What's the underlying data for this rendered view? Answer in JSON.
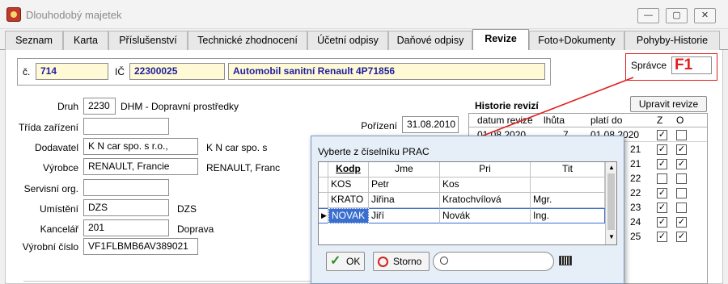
{
  "window": {
    "title": "Dlouhodobý majetek",
    "min_label": "—",
    "max_label": "▢",
    "close_label": "✕"
  },
  "tabs": [
    {
      "label": "Seznam"
    },
    {
      "label": "Karta"
    },
    {
      "label": "Příslušenství"
    },
    {
      "label": "Technické zhodnocení"
    },
    {
      "label": "Účetní odpisy"
    },
    {
      "label": "Daňové odpisy"
    },
    {
      "label": "Revize"
    },
    {
      "label": "Foto+Dokumenty"
    },
    {
      "label": "Pohyby-Historie"
    }
  ],
  "header": {
    "c_label": "č.",
    "c_value": "714",
    "ic_label": "IČ",
    "ic_value": "22300025",
    "name_value": "Automobil sanitní Renault 4P71856",
    "spravce_label": "Správce",
    "f1_annotation": "F1"
  },
  "form": {
    "druh_label": "Druh",
    "druh_code": "2230",
    "druh_text": "DHM - Dopravní prostředky",
    "trida_label": "Třída zařízení",
    "trida_value": "",
    "dodavatel_label": "Dodavatel",
    "dodavatel_value": "K N car spo. s r.o.,",
    "dodavatel_text": "K N car spo. s",
    "vyrobce_label": "Výrobce",
    "vyrobce_value": "RENAULT, Francie",
    "vyrobce_text": "RENAULT, Franc",
    "servis_label": "Servisní org.",
    "servis_value": "",
    "umisteni_label": "Umístění",
    "umisteni_value": "DZS",
    "umisteni_text": "DZS",
    "kancelar_label": "Kancelář",
    "kancelar_value": "201",
    "kancelar_text": "Doprava",
    "vyrobni_label": "Výrobní číslo",
    "vyrobni_value": "VF1FLBMB6AV389021",
    "porizeni_label": "Pořízení",
    "porizeni_value": "31.08.2010"
  },
  "revize": {
    "title": "Historie revizí",
    "edit_button": "Upravit revize",
    "columns": [
      "datum revize",
      "lhůta",
      "platí do",
      "Z",
      "O"
    ],
    "first_row": {
      "datum": "01.08.2020",
      "lhuta": "7",
      "plati": "01.08.2020"
    },
    "row_suffixes": [
      "21",
      "21",
      "22",
      "22",
      "23",
      "24",
      "25"
    ],
    "checks": [
      {
        "z": true,
        "o": false
      },
      {
        "z": true,
        "o": true
      },
      {
        "z": true,
        "o": true
      },
      {
        "z": false,
        "o": false
      },
      {
        "z": true,
        "o": false
      },
      {
        "z": true,
        "o": false
      },
      {
        "z": true,
        "o": true
      },
      {
        "z": true,
        "o": true
      }
    ]
  },
  "dialog": {
    "title": "Vyberte z číselníku PRAC",
    "columns": [
      "Kodp",
      "Jme",
      "Pri",
      "Tit"
    ],
    "rows": [
      {
        "kodp": "KOS",
        "jme": "Petr",
        "pri": "Kos",
        "tit": ""
      },
      {
        "kodp": "KRATO",
        "jme": "Jiřina",
        "pri": "Kratochvílová",
        "tit": "Mgr."
      },
      {
        "kodp": "NOVAK",
        "jme": "Jiří",
        "pri": "Novák",
        "tit": "Ing."
      }
    ],
    "ok_label": "OK",
    "storno_label": "Storno",
    "search_value": ""
  },
  "colors": {
    "annotation_red": "#e02020",
    "selected_cell": "#3a6fd0",
    "yellow_field": "#fff9d6"
  }
}
